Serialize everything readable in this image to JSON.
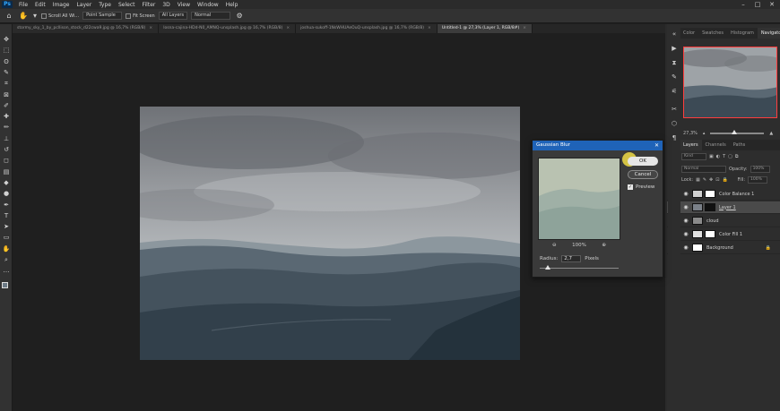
{
  "app": {
    "logo": "Ps"
  },
  "menu": [
    "File",
    "Edit",
    "Image",
    "Layer",
    "Type",
    "Select",
    "Filter",
    "3D",
    "View",
    "Window",
    "Help"
  ],
  "window_controls": {
    "minimize": "–",
    "maximize": "□",
    "close": "✕"
  },
  "options_bar": {
    "scroll_all_windows": "Scroll All Wi...",
    "sample_mode": "Point Sample",
    "fit_screen": "Fit Screen",
    "all_layers": "All Layers",
    "blend_mode": "Normal"
  },
  "tabs": [
    {
      "label": "stormy_sky_1_by_pcllison_stock_d22cwa9.jpg @ 16,7% (RGB/8)",
      "active": false
    },
    {
      "label": "losna-cajina-HDd-N0_AMNQ-unsplash.jpg @ 16,7% (RGB/8)",
      "active": false
    },
    {
      "label": "joshua-sukoff-1NsWHUAeOuQ-unsplash.jpg @ 16,7% (RGB/8)",
      "active": false
    },
    {
      "label": "Untitled-1 @ 27,3% (Layer 1, RGB/8#)",
      "active": true
    }
  ],
  "tab_close": "×",
  "tools": [
    "move-icon",
    "marquee-icon",
    "lasso-icon",
    "quick-select-icon",
    "crop-icon",
    "frame-icon",
    "eyedropper-icon",
    "healing-icon",
    "brush-icon",
    "stamp-icon",
    "history-brush-icon",
    "eraser-icon",
    "gradient-icon",
    "blur-icon",
    "dodge-icon",
    "pen-icon",
    "type-icon",
    "path-select-icon",
    "shape-icon",
    "hand-icon",
    "zoom-icon",
    "more-icon"
  ],
  "tool_glyphs": [
    "✥",
    "⬚",
    "ʘ",
    "✎",
    "⌗",
    "⊠",
    "✐",
    "✚",
    "✏",
    "⊥",
    "↺",
    "◻",
    "▤",
    "◆",
    "●",
    "✒",
    "T",
    "➤",
    "▭",
    "✋",
    "⌕",
    "…"
  ],
  "panels": {
    "top_tabs": [
      "Color",
      "Swatches",
      "Histogram",
      "Navigator"
    ],
    "top_active": "Navigator",
    "navigator_zoom": "27,3%",
    "layers_tabs": [
      "Layers",
      "Channels",
      "Paths"
    ],
    "layers_active": "Layers",
    "filter_kind": "Kind",
    "blend_mode": "Normal",
    "opacity_label": "Opacity:",
    "opacity": "100%",
    "lock_label": "Lock:",
    "fill_label": "Fill:",
    "fill": "100%",
    "layers": [
      {
        "name": "Color Balance 1",
        "thumb": "#cfcfcf",
        "selected": false,
        "locked": false,
        "type": "adjustment"
      },
      {
        "name": "Layer 1",
        "thumb": "#7a8088",
        "selected": true,
        "locked": false,
        "type": "image"
      },
      {
        "name": "cloud",
        "thumb": "#8a8a8a",
        "selected": false,
        "locked": false,
        "type": "image"
      },
      {
        "name": "Color Fill 1",
        "thumb": "#e0e0e0",
        "selected": false,
        "locked": false,
        "type": "fill"
      },
      {
        "name": "Background",
        "thumb": "#ffffff",
        "selected": false,
        "locked": true,
        "type": "background"
      }
    ],
    "lock_glyph": "🔒"
  },
  "dialog": {
    "title": "Gaussian Blur",
    "close": "✕",
    "ok_label": "OK",
    "cancel_label": "Cancel",
    "preview_label": "Preview",
    "preview_checked": true,
    "check_glyph": "✓",
    "zoom_out": "⊖",
    "zoom_in": "⊕",
    "zoom_level": "100%",
    "radius_label": "Radius:",
    "radius_value": "2,7",
    "radius_unit": "Pixels"
  },
  "colors": {
    "accent": "#1f63b8",
    "nav_frame": "#ff3d3d"
  }
}
